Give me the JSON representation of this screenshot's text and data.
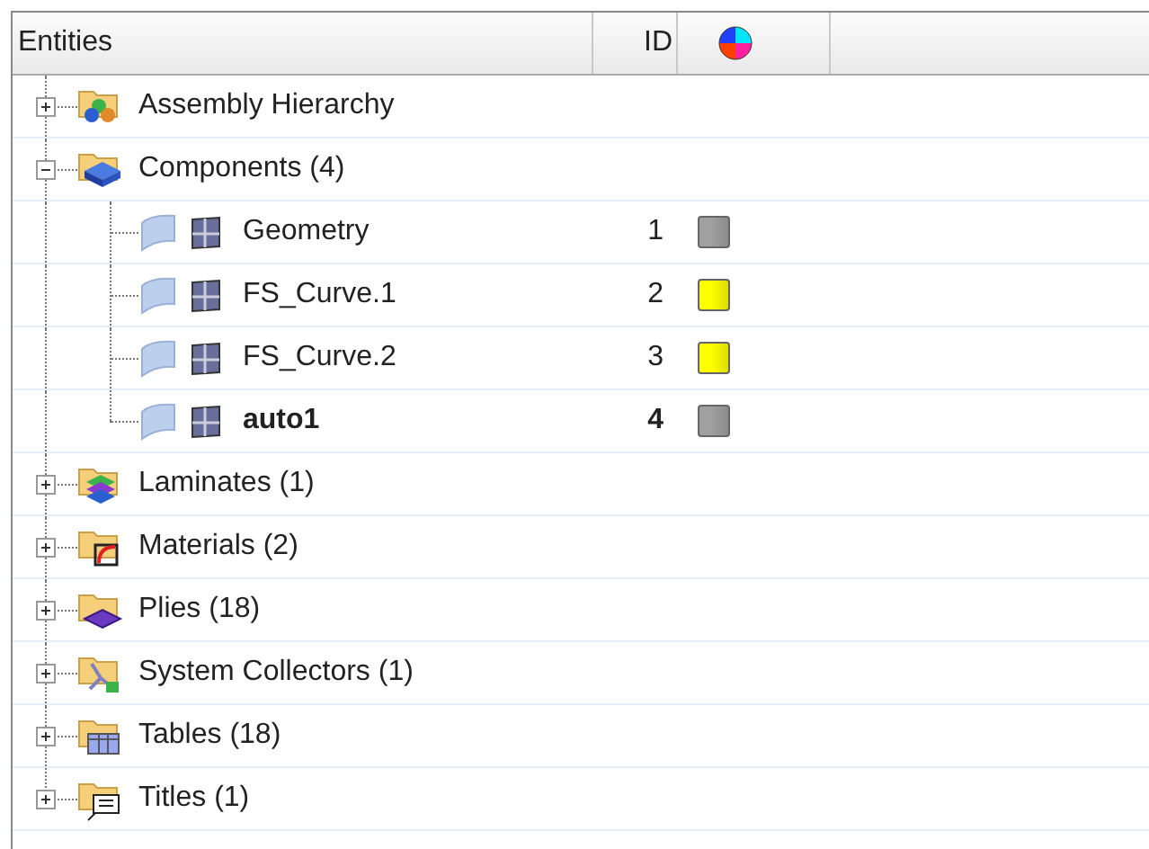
{
  "table": {
    "columns": [
      {
        "label": "Entities"
      },
      {
        "label": "ID"
      },
      {
        "kind": "color"
      }
    ],
    "rows": [
      {
        "label": "Assembly Hierarchy",
        "kind": "assembly",
        "expanded": false
      },
      {
        "label": "Components (4)",
        "kind": "components",
        "expanded": true,
        "children": [
          {
            "label": "Geometry",
            "id": "1",
            "color": "#a0a0a0",
            "current": false
          },
          {
            "label": "FS_Curve.1",
            "id": "2",
            "color": "#ffff00",
            "current": false
          },
          {
            "label": "FS_Curve.2",
            "id": "3",
            "color": "#ffff00",
            "current": false
          },
          {
            "label": "auto1",
            "id": "4",
            "color": "#a0a0a0",
            "current": true
          }
        ]
      },
      {
        "label": "Laminates (1)",
        "kind": "laminates",
        "expanded": false
      },
      {
        "label": "Materials (2)",
        "kind": "materials",
        "expanded": false
      },
      {
        "label": "Plies (18)",
        "kind": "plies",
        "expanded": false
      },
      {
        "label": "System Collectors (1)",
        "kind": "system",
        "expanded": false
      },
      {
        "label": "Tables (18)",
        "kind": "tables",
        "expanded": false
      },
      {
        "label": "Titles (1)",
        "kind": "titles",
        "expanded": false
      }
    ]
  }
}
